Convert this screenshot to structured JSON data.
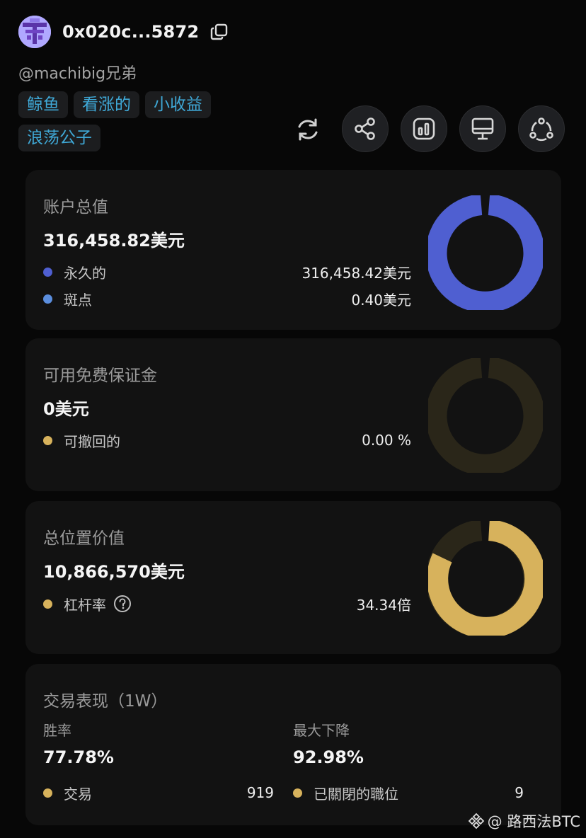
{
  "profile": {
    "address": "0x020c...5872",
    "handle": "@machibig兄弟",
    "tags": [
      "鲸鱼",
      "看涨的",
      "小收益",
      "浪荡公子"
    ]
  },
  "toolbar": {
    "icons": [
      "refresh-icon",
      "share-icon",
      "chart-icon",
      "monitor-icon",
      "network-icon"
    ]
  },
  "account_value": {
    "title": "账户总值",
    "total": "316,458.82美元",
    "items": [
      {
        "label": "永久的",
        "value": "316,458.42美元",
        "color": "#4f5fd1"
      },
      {
        "label": "斑点",
        "value": "0.40美元",
        "color": "#5b8ede"
      }
    ]
  },
  "free_margin": {
    "title": "可用免费保证金",
    "total": "0美元",
    "items": [
      {
        "label": "可撤回的",
        "value": "0.00 %",
        "color": "#d7b25c"
      }
    ]
  },
  "position_value": {
    "title": "总位置价值",
    "total": "10,866,570美元",
    "items": [
      {
        "label": "杠杆率",
        "value": "34.34倍",
        "color": "#d7b25c"
      }
    ]
  },
  "performance": {
    "title": "交易表现（1W）",
    "win_rate_label": "胜率",
    "win_rate": "77.78%",
    "drawdown_label": "最大下降",
    "drawdown": "92.98%",
    "trades_label": "交易",
    "trades": "919",
    "closed_label": "已關閉的職位",
    "closed": "9"
  },
  "colors": {
    "accent_blue": "#4f5fd1",
    "accent_gold": "#d7b25c",
    "tag_text": "#3fa8d6"
  },
  "watermark": "@ 路西法BTC"
}
